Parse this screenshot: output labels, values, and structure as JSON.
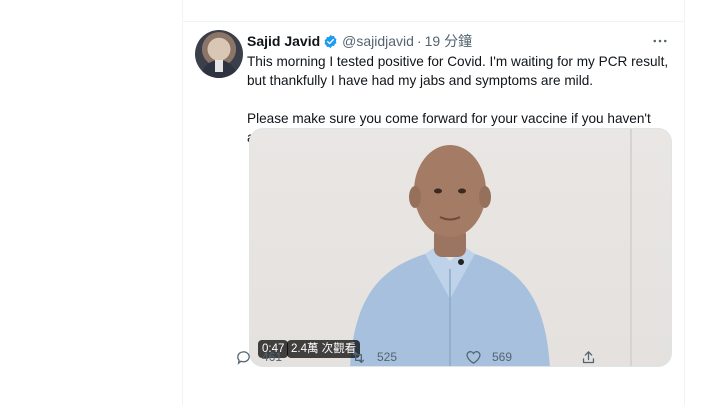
{
  "tweet": {
    "author_name": "Sajid Javid",
    "handle": "@sajidjavid",
    "separator": "·",
    "time": "19 分鐘",
    "more_icon": "more-horizontal-icon",
    "verified_icon": "verified-badge-icon",
    "paragraph1": "This morning I tested positive for Covid. I'm waiting for my PCR result, but thankfully I have had my jabs and symptoms are mild.",
    "paragraph2": "Please make sure you come forward for your vaccine if you haven't already."
  },
  "video": {
    "duration": "0:47",
    "views": "2.4萬 次觀看"
  },
  "actions": {
    "reply_count": "461",
    "retweet_count": "525",
    "like_count": "569"
  },
  "colors": {
    "accent": "#1d9bf0",
    "secondary_text": "#536471",
    "primary_text": "#0f1419",
    "border": "#eff3f4"
  }
}
